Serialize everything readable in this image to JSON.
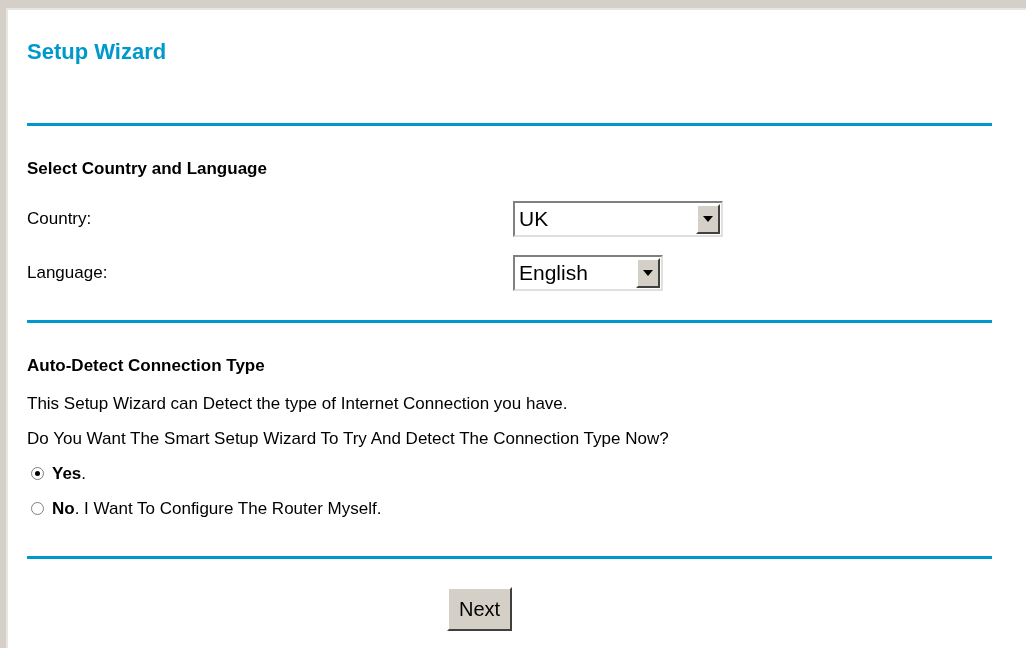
{
  "title": "Setup Wizard",
  "country_language": {
    "heading": "Select Country and Language",
    "fields": [
      {
        "label": "Country:",
        "value": "UK"
      },
      {
        "label": "Language:",
        "value": "English"
      }
    ]
  },
  "auto_detect": {
    "heading": "Auto-Detect Connection Type",
    "lines": [
      "This Setup Wizard can Detect the type of Internet Connection you have.",
      "Do You Want The Smart Setup Wizard To Try And Detect The Connection Type Now?"
    ],
    "options": [
      {
        "label": "**Yes**.",
        "selected": true
      },
      {
        "label": "**No**. I Want To Configure The Router Myself.",
        "selected": false
      }
    ]
  },
  "next_button": "Next"
}
